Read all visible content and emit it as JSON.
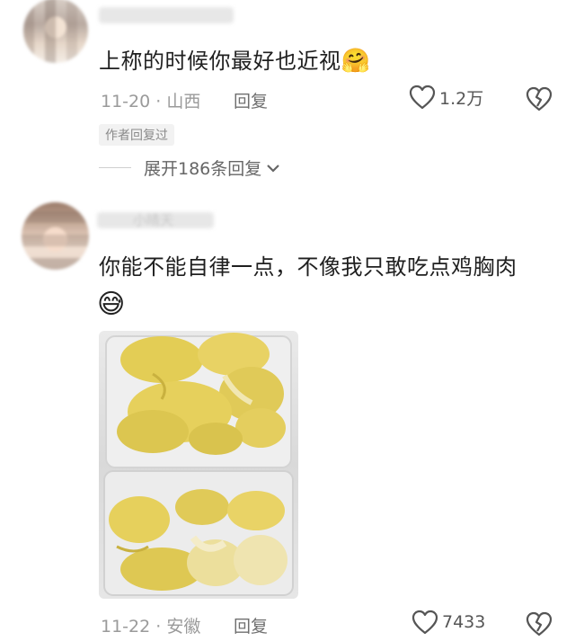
{
  "comments": [
    {
      "text": "上称的时候你最好也近视",
      "emoji": "🤗",
      "date": "11-20",
      "location": "山西",
      "reply_label": "回复",
      "likes": "1.2万",
      "author_tag": "作者回复过",
      "expand_label": "展开186条回复"
    },
    {
      "username_visible": "小晴天",
      "text": "你能不能自律一点，不像我只敢吃点鸡胸肉",
      "emoji": "😅",
      "date": "11-22",
      "location": "安徽",
      "reply_label": "回复",
      "likes": "7433"
    }
  ],
  "separator": "·",
  "colors": {
    "text_primary": "#1f1f1f",
    "text_meta": "#9a9a9a",
    "durian_yellow": "#e8d15c"
  },
  "icons": [
    "heart-outline-icon",
    "broken-heart-icon",
    "chevron-down-icon",
    "smiley-emoji",
    "hug-emoji"
  ]
}
